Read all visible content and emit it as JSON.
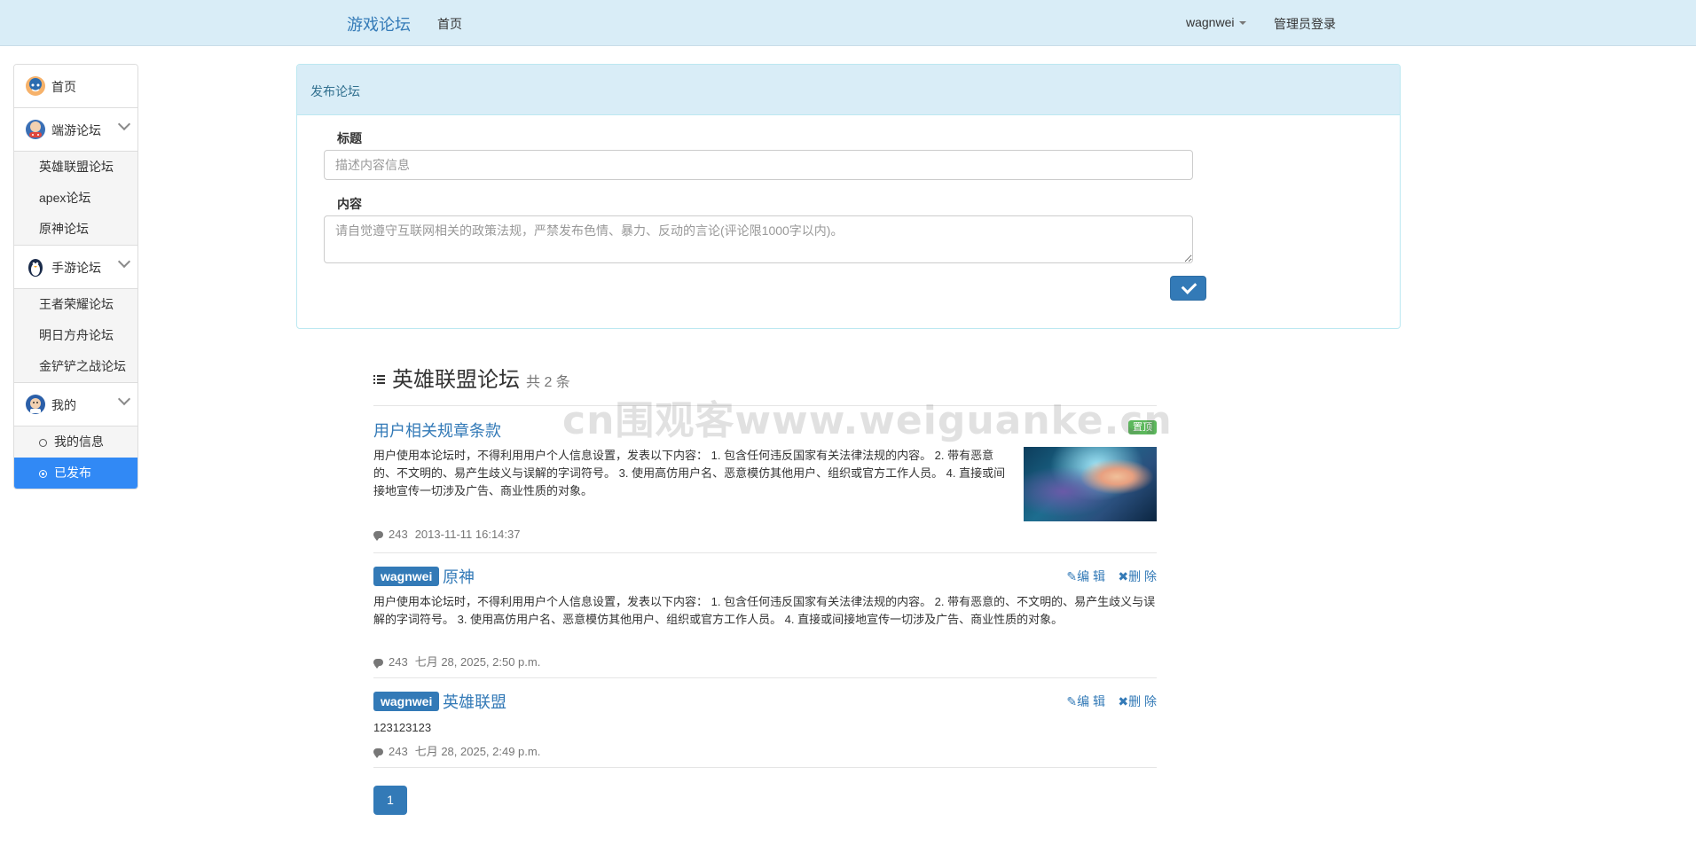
{
  "navbar": {
    "brand": "游戏论坛",
    "home": "首页",
    "username": "wagnwei",
    "admin_login": "管理员登录"
  },
  "sidebar": {
    "home": "首页",
    "groups": [
      {
        "label": "端游论坛",
        "items": [
          "英雄联盟论坛",
          "apex论坛",
          "原神论坛"
        ]
      },
      {
        "label": "手游论坛",
        "items": [
          "王者荣耀论坛",
          "明日方舟论坛",
          "金铲铲之战论坛"
        ]
      },
      {
        "label": "我的",
        "items": [
          "我的信息",
          "已发布"
        ]
      }
    ],
    "active_item": "已发布"
  },
  "publish": {
    "panel_title": "发布论坛",
    "title_label": "标题",
    "title_placeholder": "描述内容信息",
    "title_value": "",
    "content_label": "内容",
    "content_placeholder": "请自觉遵守互联网相关的政策法规，严禁发布色情、暴力、反动的言论(评论限1000字以内)。",
    "content_value": ""
  },
  "list": {
    "title": "英雄联盟论坛",
    "count": "共 2 条",
    "posts": [
      {
        "title": "用户相关规章条款",
        "badge": "置顶",
        "body": "用户使用本论坛时，不得利用用户个人信息设置，发表以下内容： 1. 包含任何违反国家有关法律法规的内容。 2. 带有恶意的、不文明的、易产生歧义与误解的字词符号。 3. 使用高仿用户名、恶意模仿其他用户、组织或官方工作人员。 4. 直接或间接地宣传一切涉及广告、商业性质的对象。",
        "comments": "243",
        "time": "2013-11-11 16:14:37"
      },
      {
        "user": "wagnwei",
        "title": "原神",
        "edit": "编 辑",
        "delete": "删 除",
        "body": "用户使用本论坛时，不得利用用户个人信息设置，发表以下内容： 1. 包含任何违反国家有关法律法规的内容。 2. 带有恶意的、不文明的、易产生歧义与误解的字词符号。 3. 使用高仿用户名、恶意模仿其他用户、组织或官方工作人员。 4. 直接或间接地宣传一切涉及广告、商业性质的对象。",
        "comments": "243",
        "time": "七月 28, 2025, 2:50 p.m."
      },
      {
        "user": "wagnwei",
        "title": "英雄联盟",
        "edit": "编 辑",
        "delete": "删 除",
        "body": "123123123",
        "comments": "243",
        "time": "七月 28, 2025, 2:49 p.m."
      }
    ]
  },
  "pagination": {
    "current": "1"
  },
  "watermark": "cn围观客www.weiguanke.cn",
  "colors": {
    "navbar_bg": "#d9edf7",
    "primary": "#337ab7",
    "active_item": "#3189f5",
    "badge_green": "#5cb85c"
  }
}
